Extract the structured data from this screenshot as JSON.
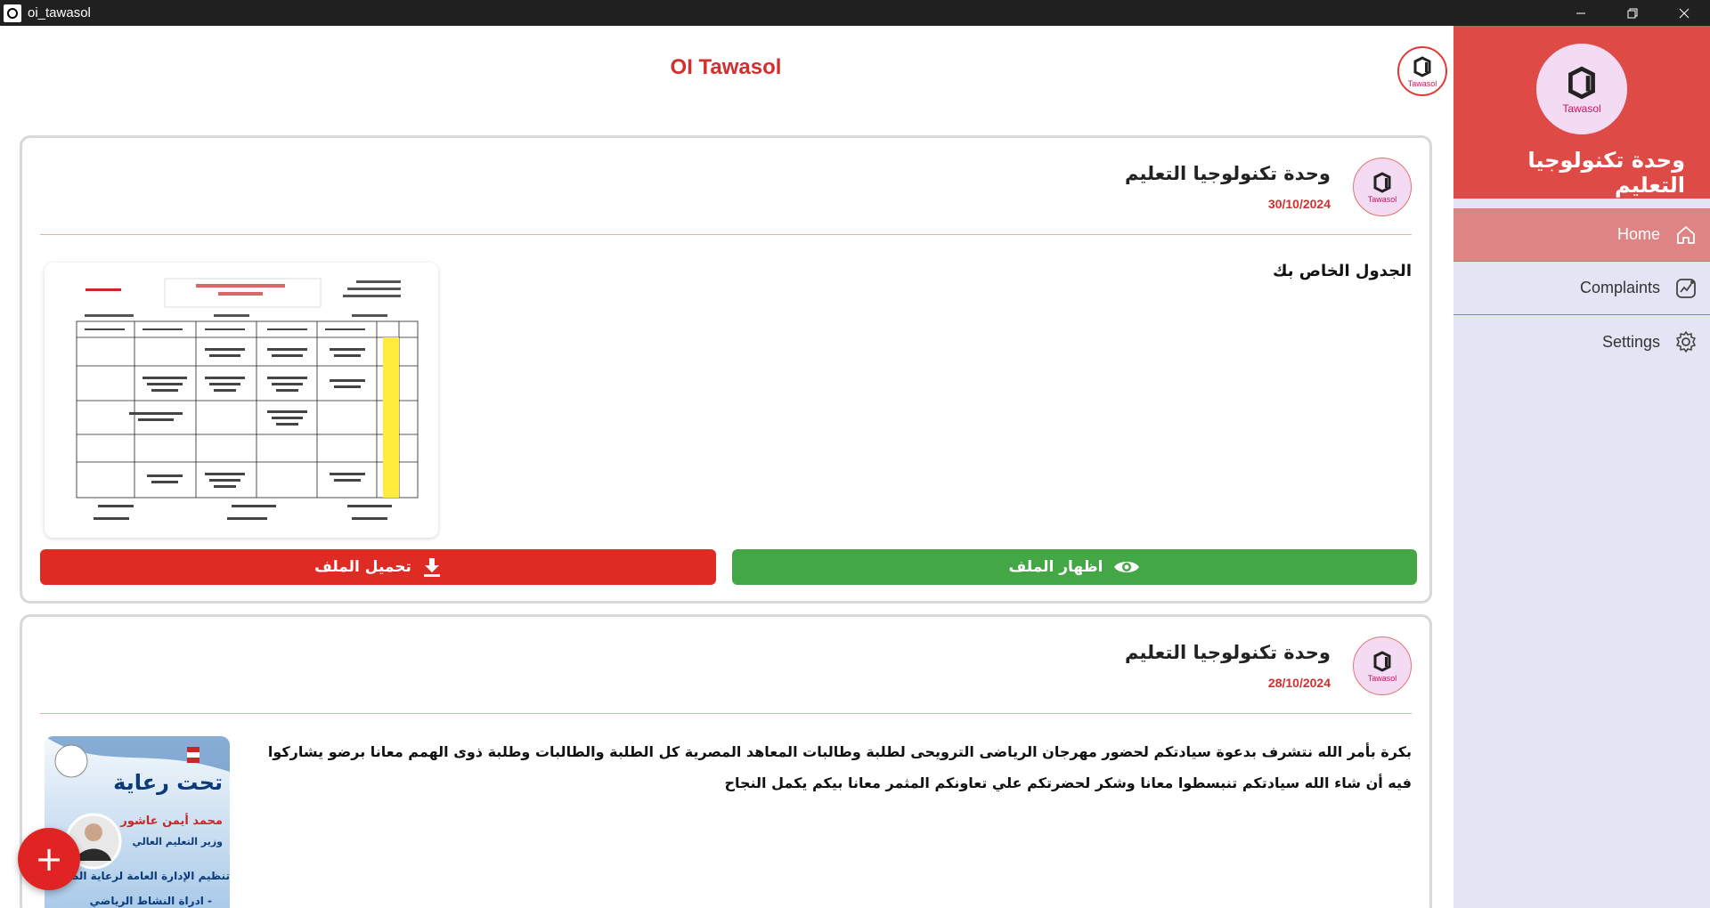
{
  "window": {
    "title": "oi_tawasol"
  },
  "header": {
    "title": "OI Tawasol",
    "logo_text": "Tawasol"
  },
  "sidebar": {
    "org_name": "وحدة تكنولوجيا التعليم",
    "avatar_text": "Tawasol",
    "items": [
      {
        "label": "Home",
        "icon": "home-icon",
        "active": true
      },
      {
        "label": "Complaints",
        "icon": "chart-icon",
        "active": false
      },
      {
        "label": "Settings",
        "icon": "gear-icon",
        "active": false
      }
    ]
  },
  "posts": [
    {
      "author": "وحدة تكنولوجيا التعليم",
      "date": "30/10/2024",
      "avatar_text": "Tawasol",
      "text": "الجدول الخاص بك",
      "attachment": "schedule-image",
      "download_label": "تحميل الملف",
      "view_label": "اظهار الملف"
    },
    {
      "author": "وحدة تكنولوجيا التعليم",
      "date": "28/10/2024",
      "avatar_text": "Tawasol",
      "text": "بكرة بأمر الله نتشرف بدعوة سيادتكم لحضور مهرجان الرياضى الترويحى لطلبة وطالبات المعاهد المصرية كل الطلبة والطالبات وطلبة ذوى الهمم معانا برضو يشاركوا فيه أن شاء الله سيادتكم تنبسطوا معانا وشكر لحضرتكم علي تعاونكم المثمر  معانا بيكم يكمل النجاح",
      "attachment": "poster-image",
      "poster_title": "تحت رعاية",
      "poster_name": "محمد أيمن عاشور",
      "poster_role": "وزير التعليم العالي",
      "poster_line1": "تنظيم الإدارة العامة لرعاية الط",
      "poster_line2": "- ادراة النشاط الرياضي"
    }
  ],
  "fab": {
    "label": "+"
  },
  "colors": {
    "accent": "#de4b47",
    "download": "#de2b24",
    "view": "#43a745",
    "date": "#d32f2f"
  }
}
